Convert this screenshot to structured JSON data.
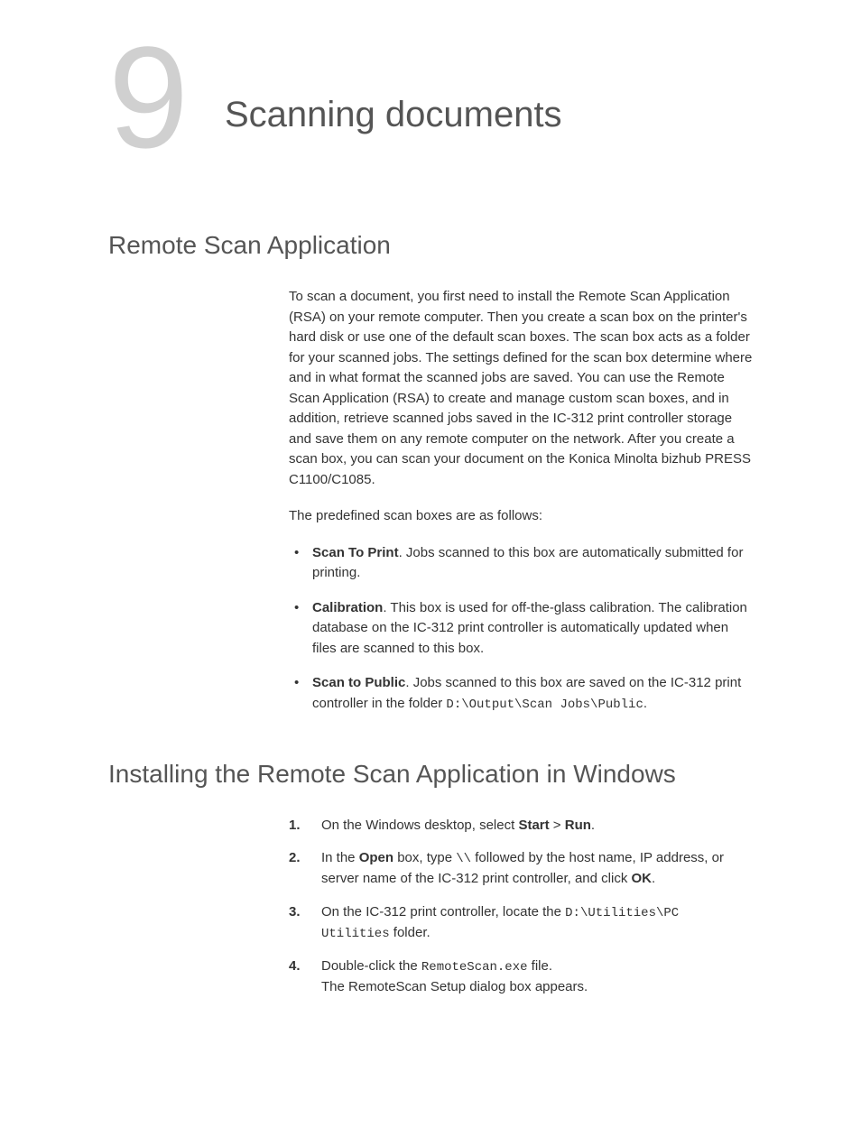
{
  "chapter": {
    "number": "9",
    "title": "Scanning documents"
  },
  "section1": {
    "heading": "Remote Scan Application",
    "para1": "To scan a document, you first need to install the Remote Scan Application (RSA) on your remote computer. Then you create a scan box on the printer's hard disk or use one of the default scan boxes. The scan box acts as a folder for your scanned jobs. The settings defined for the scan box determine where and in what format the scanned jobs are saved. You can use the Remote Scan Application (RSA) to create and manage custom scan boxes, and in addition, retrieve scanned jobs saved in the IC-312 print controller storage and save them on any remote computer on the network. After you create a scan box, you can scan your document on the Konica Minolta bizhub PRESS C1100/C1085.",
    "para2": "The predefined scan boxes are as follows:",
    "bullets": {
      "b1_bold": "Scan To Print",
      "b1_rest": ". Jobs scanned to this box are automatically submitted for printing.",
      "b2_bold": "Calibration",
      "b2_rest": ". This box is used for off-the-glass calibration. The calibration database on the IC-312 print controller is automatically updated when files are scanned to this box.",
      "b3_bold": "Scan to Public",
      "b3_rest_a": ". Jobs scanned to this box are saved on the IC-312 print controller in the folder ",
      "b3_mono": "D:\\Output\\Scan Jobs\\Public",
      "b3_rest_b": "."
    }
  },
  "section2": {
    "heading": "Installing the Remote Scan Application in Windows",
    "steps": {
      "s1_num": "1.",
      "s1_a": "On the Windows desktop, select ",
      "s1_start": "Start",
      "s1_gt": " > ",
      "s1_run": "Run",
      "s1_end": ".",
      "s2_num": "2.",
      "s2_a": "In the ",
      "s2_open": "Open",
      "s2_b": " box, type ",
      "s2_mono": "\\\\",
      "s2_c": " followed by the host name, IP address, or server name of the IC-312 print controller, and click ",
      "s2_ok": "OK",
      "s2_end": ".",
      "s3_num": "3.",
      "s3_a": "On the IC-312 print controller, locate the ",
      "s3_mono": "D:\\Utilities\\PC Utilities",
      "s3_b": " folder.",
      "s4_num": "4.",
      "s4_a": "Double-click the ",
      "s4_mono": "RemoteScan.exe",
      "s4_b": " file.",
      "s4_c": "The RemoteScan Setup dialog box appears."
    }
  }
}
